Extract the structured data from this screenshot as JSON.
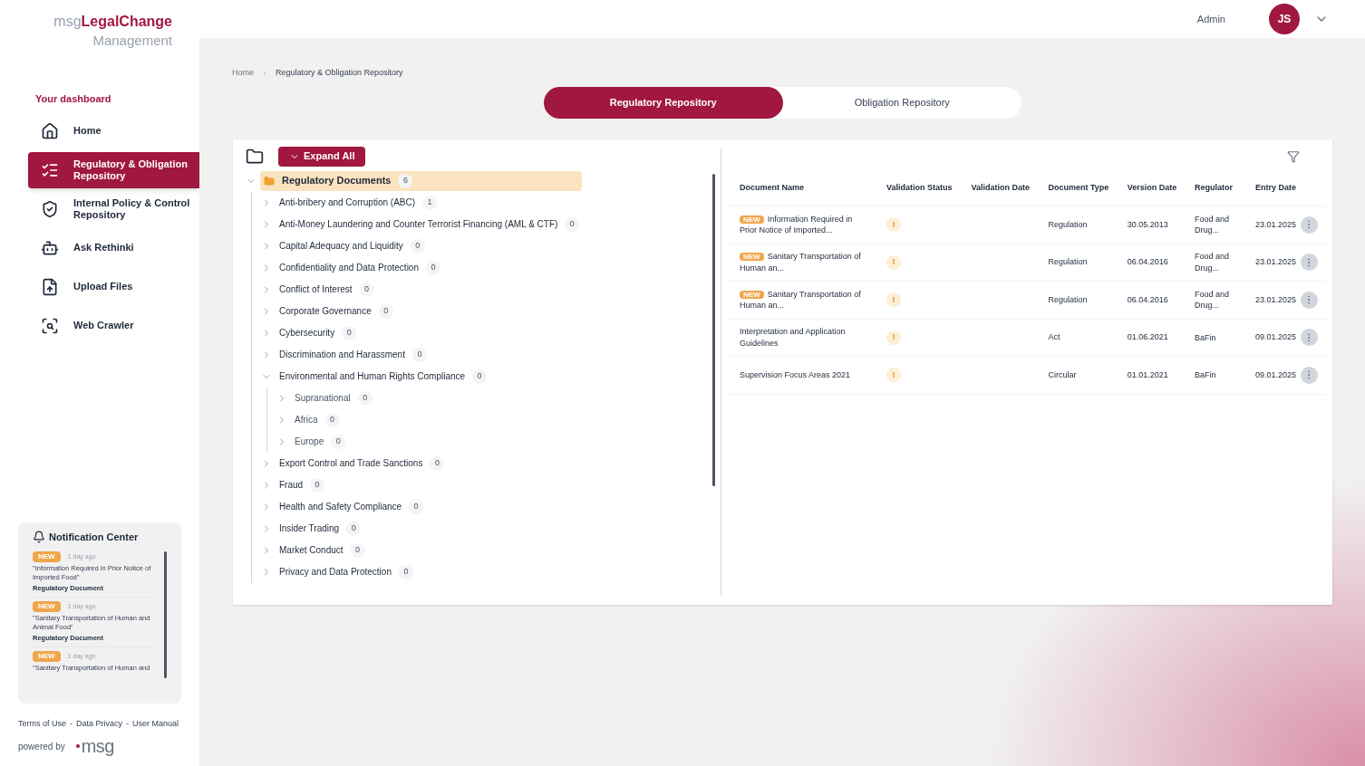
{
  "brand": {
    "prefix": "msg",
    "name": "LegalChange",
    "subtitle": "Management"
  },
  "sidebar": {
    "heading": "Your dashboard",
    "items": [
      {
        "label": "Home",
        "selected": false
      },
      {
        "label": "Regulatory & Obligation Repository",
        "selected": true
      },
      {
        "label": "Internal Policy & Control Repository",
        "selected": false
      },
      {
        "label": "Ask Rethinki",
        "selected": false
      },
      {
        "label": "Upload Files",
        "selected": false
      },
      {
        "label": "Web Crawler",
        "selected": false
      }
    ]
  },
  "notifications": {
    "title": "Notification Center",
    "items": [
      {
        "badge": "NEW",
        "time": "1 day ago",
        "text": "\"Information Required in Prior Notice of Imported Food\"",
        "category": "Regulatory Document"
      },
      {
        "badge": "NEW",
        "time": "1 day ago",
        "text": "\"Sanitary Transportation of Human and Animal Food\"",
        "category": "Regulatory Document"
      },
      {
        "badge": "NEW",
        "time": "1 day ago",
        "text": "\"Sanitary Transportation of Human and"
      }
    ]
  },
  "footer": {
    "links": [
      "Terms of Use",
      "Data Privacy",
      "User Manual"
    ],
    "separator": "-",
    "powered_by": "powered by",
    "logo": "msg"
  },
  "header": {
    "user_role": "Admin",
    "initials": "JS"
  },
  "breadcrumb": [
    "Home",
    "Regulatory & Obligation Repository"
  ],
  "tabs": [
    {
      "label": "Regulatory Repository",
      "selected": true
    },
    {
      "label": "Obligation Repository",
      "selected": false
    }
  ],
  "tree": {
    "expand_button": "Expand All",
    "root": {
      "label": "Regulatory Documents",
      "count": "6",
      "selected": true,
      "expanded": true,
      "children": [
        {
          "label": "Anti-bribery and Corruption (ABC)",
          "count": "1",
          "expanded": false
        },
        {
          "label": "Anti-Money Laundering and Counter Terrorist Financing (AML & CTF)",
          "count": "0",
          "expanded": false
        },
        {
          "label": "Capital Adequacy and Liquidity",
          "count": "0",
          "expanded": false
        },
        {
          "label": "Confidentiality and Data Protection",
          "count": "0",
          "expanded": false
        },
        {
          "label": "Conflict of Interest",
          "count": "0",
          "expanded": false
        },
        {
          "label": "Corporate Governance",
          "count": "0",
          "expanded": false
        },
        {
          "label": "Cybersecurity",
          "count": "0",
          "expanded": false
        },
        {
          "label": "Discrimination and Harassment",
          "count": "0",
          "expanded": false
        },
        {
          "label": "Environmental and Human Rights Compliance",
          "count": "0",
          "expanded": true,
          "children": [
            {
              "label": "Supranational",
              "count": "0",
              "expanded": false
            },
            {
              "label": "Africa",
              "count": "0",
              "expanded": false
            },
            {
              "label": "Europe",
              "count": "0",
              "expanded": false
            }
          ]
        },
        {
          "label": "Export Control and Trade Sanctions",
          "count": "0",
          "expanded": false
        },
        {
          "label": "Fraud",
          "count": "0",
          "expanded": false
        },
        {
          "label": "Health and Safety Compliance",
          "count": "0",
          "expanded": false
        },
        {
          "label": "Insider Trading",
          "count": "0",
          "expanded": false
        },
        {
          "label": "Market Conduct",
          "count": "0",
          "expanded": false
        },
        {
          "label": "Privacy and Data Protection",
          "count": "0",
          "expanded": false
        }
      ]
    }
  },
  "table": {
    "columns": [
      "Document Name",
      "Validation Status",
      "Validation Date",
      "Document Type",
      "Version Date",
      "Regulator",
      "Entry Date"
    ],
    "rows": [
      {
        "badge": "NEW",
        "name": "Information Required in Prior Notice of Imported...",
        "status": "!",
        "type": "Regulation",
        "version_date": "30.05.2013",
        "regulator": "Food and Drug...",
        "entry_date": "23.01.2025"
      },
      {
        "badge": "NEW",
        "name": "Sanitary Transportation of Human an...",
        "status": "!",
        "type": "Regulation",
        "version_date": "06.04.2016",
        "regulator": "Food and Drug...",
        "entry_date": "23.01.2025"
      },
      {
        "badge": "NEW",
        "name": "Sanitary Transportation of Human an...",
        "status": "!",
        "type": "Regulation",
        "version_date": "06.04.2016",
        "regulator": "Food and Drug...",
        "entry_date": "23.01.2025"
      },
      {
        "name": "Interpretation and Application Guidelines",
        "status": "!",
        "type": "Act",
        "version_date": "01.06.2021",
        "regulator": "BaFin",
        "entry_date": "09.01.2025"
      },
      {
        "name": "Supervision Focus Areas 2021",
        "status": "!",
        "type": "Circular",
        "version_date": "01.01.2021",
        "regulator": "BaFin",
        "entry_date": "09.01.2025"
      }
    ]
  }
}
